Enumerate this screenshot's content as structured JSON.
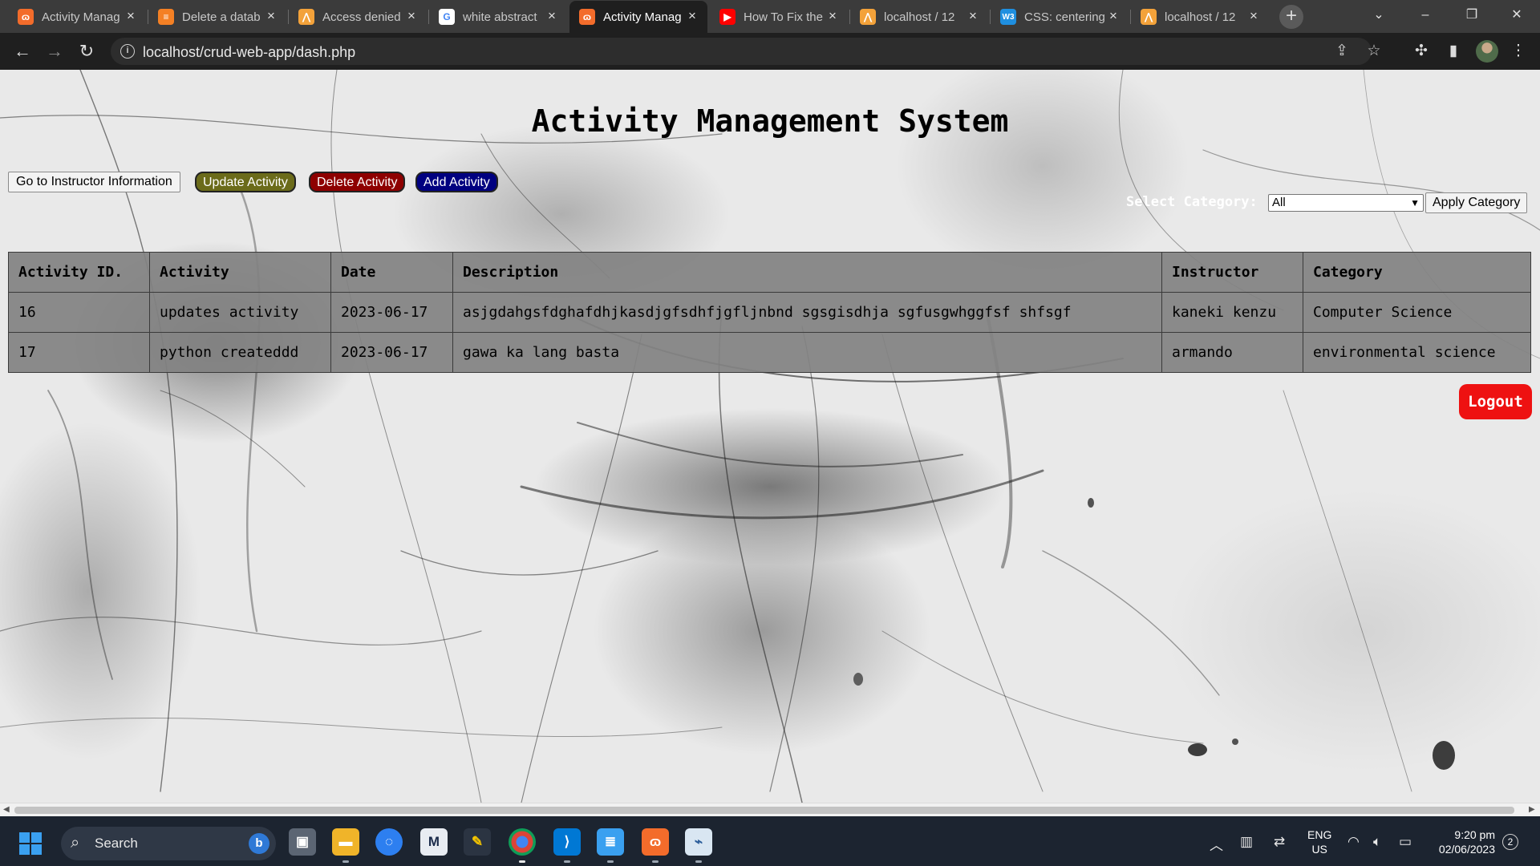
{
  "browser": {
    "tabs": [
      {
        "title": "Activity Manag",
        "favicon": "xampp-icon",
        "color": "#f36c2b",
        "glyph": "ɷ"
      },
      {
        "title": "Delete a datab",
        "favicon": "stackoverflow-icon",
        "color": "#f48024",
        "glyph": "≡"
      },
      {
        "title": "Access denied",
        "favicon": "phpmyadmin-icon",
        "color": "#f3a23a",
        "glyph": "⋀"
      },
      {
        "title": "white abstract",
        "favicon": "google-icon",
        "color": "#ffffff",
        "glyph": "G"
      },
      {
        "title": "Activity Manag",
        "favicon": "xampp-icon",
        "color": "#f36c2b",
        "glyph": "ɷ"
      },
      {
        "title": "How To Fix the",
        "favicon": "youtube-icon",
        "color": "#ff0000",
        "glyph": "▶"
      },
      {
        "title": "localhost / 12",
        "favicon": "phpmyadmin-icon",
        "color": "#f3a23a",
        "glyph": "⋀"
      },
      {
        "title": "CSS: centering",
        "favicon": "w3schools-icon",
        "color": "#1f8fe0",
        "glyph": "W3"
      },
      {
        "title": "localhost / 12",
        "favicon": "phpmyadmin-icon",
        "color": "#f3a23a",
        "glyph": "⋀"
      }
    ],
    "active_tab": 4,
    "url": "localhost/crud-web-app/dash.php"
  },
  "page": {
    "title": "Activity Management System",
    "buttons": {
      "instructor": "Go to Instructor Information",
      "update": "Update Activity",
      "delete": "Delete Activity",
      "add": "Add Activity",
      "apply": "Apply Category",
      "logout": "Logout"
    },
    "category": {
      "label": "Select Category:",
      "selected": "All"
    },
    "table": {
      "headers": [
        "Activity ID.",
        "Activity",
        "Date",
        "Description",
        "Instructor",
        "Category"
      ],
      "rows": [
        [
          "16",
          "updates activity",
          "2023-06-17",
          "asjgdahgsfdghafdhjkasdjgfsdhfjgfljnbnd sgsgisdhja sgfusgwhggfsf shfsgf",
          "kaneki kenzu",
          "Computer Science"
        ],
        [
          "17",
          "python createddd",
          "2023-06-17",
          "gawa ka lang basta",
          "armando",
          "environmental science"
        ]
      ]
    }
  },
  "taskbar": {
    "search_label": "Search",
    "lang_line1": "ENG",
    "lang_line2": "US",
    "time": "9:20 pm",
    "date": "02/06/2023",
    "notification_count": "2",
    "apps": [
      "task-view-icon",
      "file-explorer-icon",
      "messenger-icon",
      "mail-icon",
      "flyer-icon",
      "chrome-icon",
      "vscode-icon",
      "notepad-icon",
      "xampp-icon",
      "monitor-icon"
    ]
  },
  "colors": {
    "update_button": "#6b6b1a",
    "delete_button": "#8e0000",
    "add_button": "#000080",
    "logout_button": "#ee1111",
    "table_background": "#828282"
  }
}
